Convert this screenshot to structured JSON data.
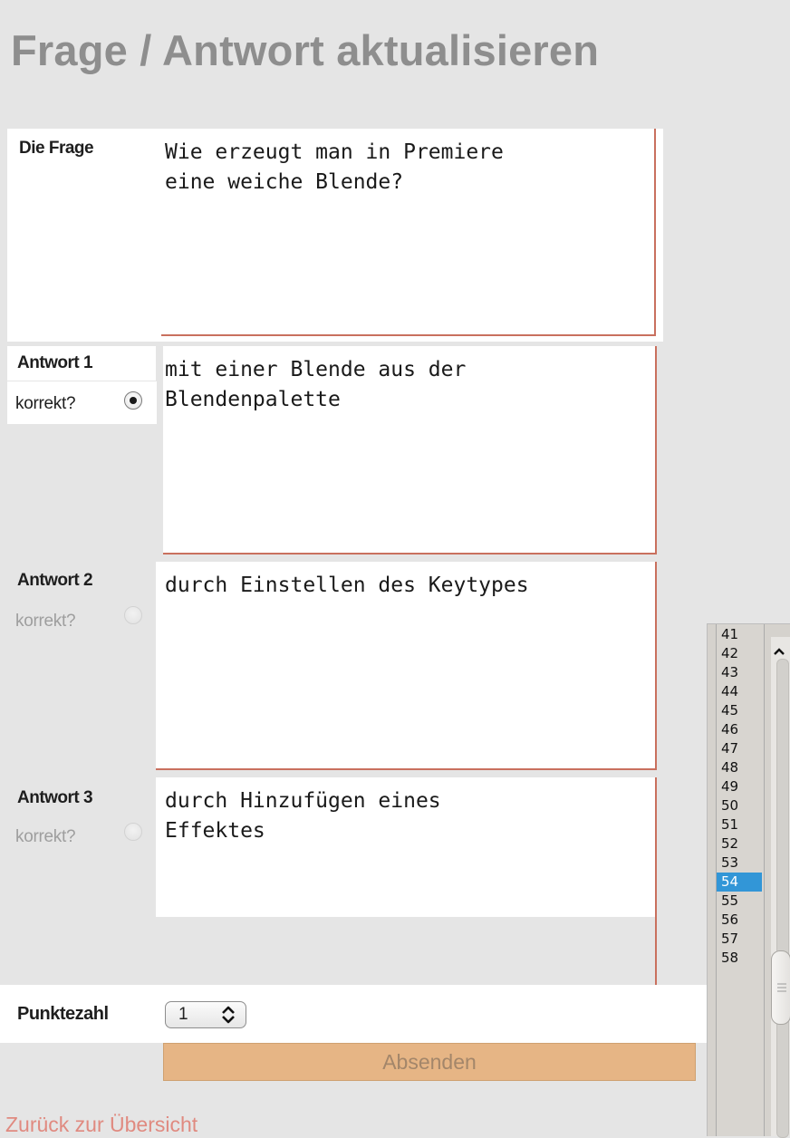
{
  "page": {
    "title": "Frage / Antwort aktualisieren"
  },
  "question": {
    "label": "Die Frage",
    "text": "Wie erzeugt man in Premiere\neine weiche Blende?"
  },
  "answers": [
    {
      "label": "Antwort 1",
      "correct_label": "korrekt?",
      "checked": true,
      "text": "mit einer Blende aus der\nBlendenpalette"
    },
    {
      "label": "Antwort 2",
      "correct_label": "korrekt?",
      "checked": false,
      "text": "durch Einstellen des Keytypes"
    },
    {
      "label": "Antwort 3",
      "correct_label": "korrekt?",
      "checked": false,
      "text": "durch Hinzufügen eines\nEffektes"
    }
  ],
  "points": {
    "label": "Punktezahl",
    "value": "1",
    "arrow_icon": "up-down-chevron-icon"
  },
  "submit": {
    "label": "Absenden"
  },
  "back_link": {
    "label": "Zurück zur Übersicht"
  },
  "dropdown": {
    "items": [
      "41",
      "42",
      "43",
      "44",
      "45",
      "46",
      "47",
      "48",
      "49",
      "50",
      "51",
      "52",
      "53",
      "54",
      "55",
      "56",
      "57",
      "58"
    ],
    "selected": "54",
    "scroll_up_icon": "chevron-up-icon"
  },
  "colors": {
    "textarea_border": "#c9705e",
    "submit_bg": "#e6b585",
    "link": "#e08a80",
    "selection": "#3296d7"
  }
}
